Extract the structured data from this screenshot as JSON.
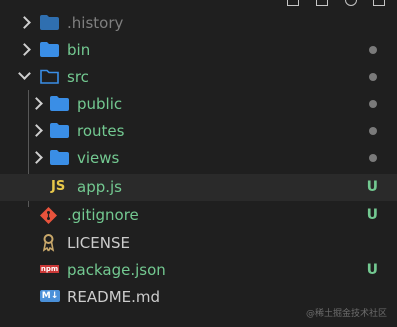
{
  "colors": {
    "folder": "#3a8ee6",
    "untracked": "#73c991",
    "ignored": "#7f7f7f",
    "normal": "#cccccc",
    "untracked_badge": "#73c991"
  },
  "tree": {
    "history": {
      "label": ".history"
    },
    "bin": {
      "label": "bin"
    },
    "src": {
      "label": "src"
    },
    "public": {
      "label": "public"
    },
    "routes": {
      "label": "routes"
    },
    "views": {
      "label": "views"
    },
    "app": {
      "label": "app.js",
      "icon_text": "JS",
      "badge": "U"
    },
    "gitignore": {
      "label": ".gitignore",
      "badge": "U"
    },
    "license": {
      "label": "LICENSE"
    },
    "package": {
      "label": "package.json",
      "icon_text": "npm",
      "badge": "U"
    },
    "readme": {
      "label": "README.md",
      "icon_text": "M↓"
    }
  },
  "watermark": "@稀土掘金技术社区"
}
